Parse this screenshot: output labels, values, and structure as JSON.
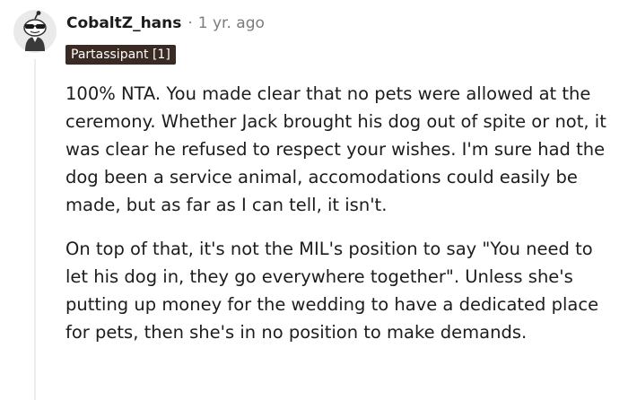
{
  "comment": {
    "username": "CobaltZ_hans",
    "separator": "·",
    "timestamp": "1 yr. ago",
    "flair": "Partassipant [1]",
    "avatar_icon": "snoo-avatar-with-sunglasses-icon",
    "paragraphs": [
      "100% NTA. You made clear that no pets were allowed at the ceremony. Whether Jack brought his dog out of spite or not, it was clear he refused to respect your wishes. I'm sure had the dog been a service animal, accomodations could easily be made, but as far as I can tell, it isn't.",
      "On top of that, it's not the MIL's position to say \"You need to let his dog in, they go everywhere together\". Unless she's putting up money for the wedding to have a dedicated place for pets, then she's in no position to make demands."
    ]
  },
  "colors": {
    "text": "#1c1c1c",
    "meta": "#7c7c7c",
    "flair_bg": "#3a2a24",
    "thread_line": "#ededed"
  }
}
